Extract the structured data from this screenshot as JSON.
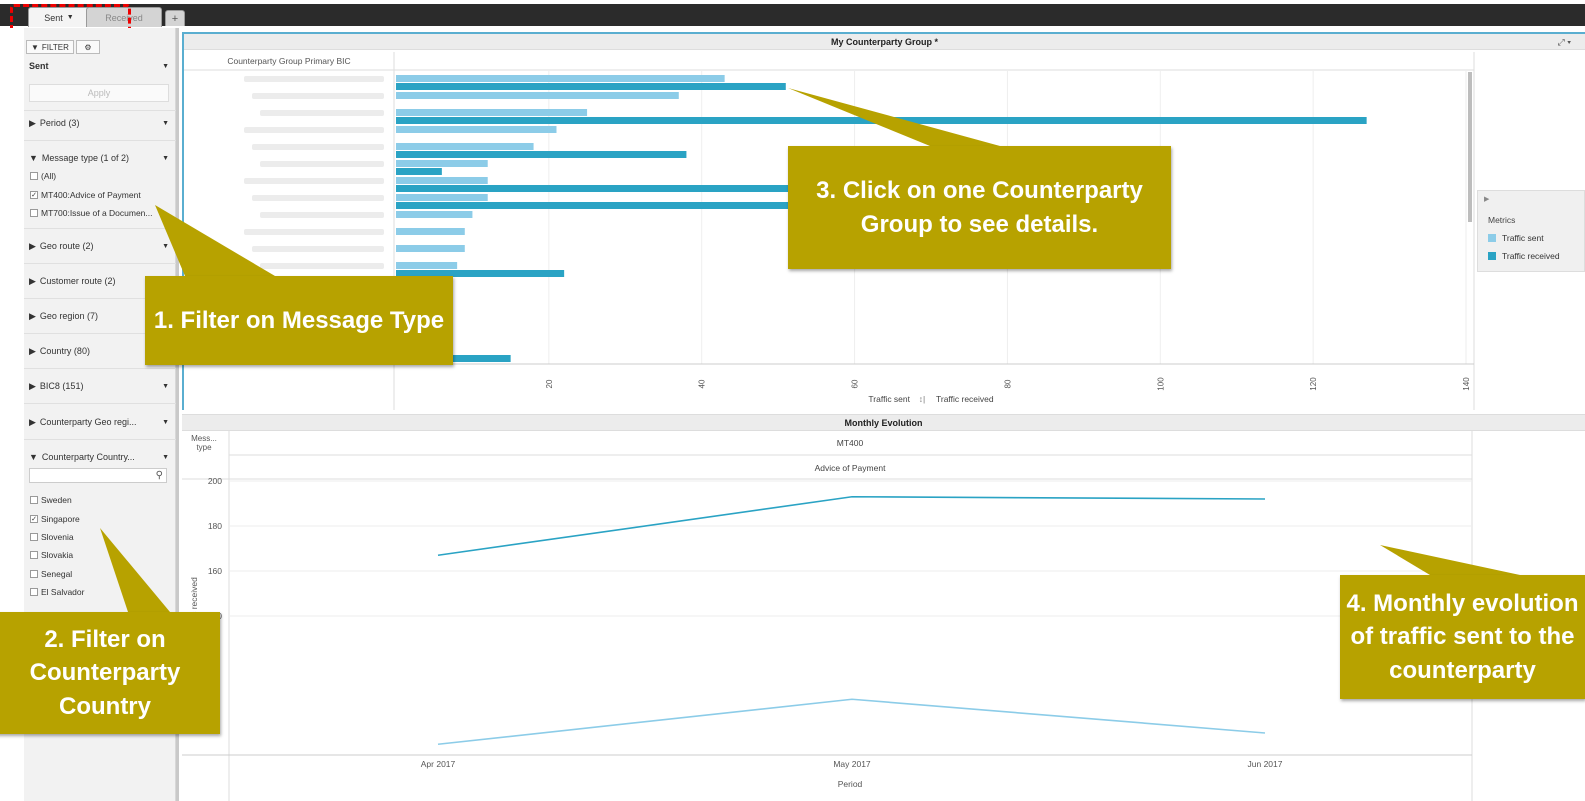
{
  "tabs": [
    {
      "label": "Sent",
      "active": true
    },
    {
      "label": "Received",
      "active": false
    }
  ],
  "add_tab": "+",
  "sidebar": {
    "filter_tab": "FILTER",
    "view_select": "Sent",
    "apply": "Apply",
    "sections": {
      "period": "Period (3)",
      "message_type": "Message type (1 of 2)",
      "geo_route": "Geo route (2)",
      "customer_route": "Customer route (2)",
      "geo_region": "Geo region (7)",
      "country": "Country (80)",
      "bic8": "BIC8 (151)",
      "cp_geo_region": "Counterparty Geo regi...",
      "cp_country": "Counterparty Country..."
    },
    "message_type_options": [
      {
        "label": "(All)",
        "checked": false
      },
      {
        "label": "MT400:Advice of Payment",
        "checked": true
      },
      {
        "label": "MT700:Issue of a Documen...",
        "checked": false
      }
    ],
    "country_options": [
      {
        "label": "Sweden",
        "checked": false
      },
      {
        "label": "Singapore",
        "checked": true
      },
      {
        "label": "Slovenia",
        "checked": false
      },
      {
        "label": "Slovakia",
        "checked": false
      },
      {
        "label": "Senegal",
        "checked": false
      },
      {
        "label": "El Salvador",
        "checked": false
      }
    ]
  },
  "colors": {
    "traffic_sent": "#8ccce8",
    "traffic_received": "#2aa3c4",
    "callout": "#b7a200",
    "panel_border": "#5aaed0"
  },
  "top_panel": {
    "title": "My Counterparty Group *",
    "column_header": "Counterparty Group Primary BIC",
    "axis_caption_sent": "Traffic sent",
    "axis_caption_received": "Traffic received"
  },
  "legend": {
    "title": "Metrics",
    "items": [
      "Traffic sent",
      "Traffic received"
    ]
  },
  "bottom_panel": {
    "title": "Monthly Evolution",
    "mess_type_header": "Mess... type",
    "mt": "MT400",
    "mt_desc": "Advice of Payment",
    "period_label": "Period",
    "ylabel": "Traffic received"
  },
  "callouts": {
    "c1": "1. Filter on Message Type",
    "c2": "2. Filter on Counterparty Country",
    "c3": "3. Click on one Counterparty Group to see details.",
    "c4": "4. Monthly evolution of traffic sent to the counterparty"
  },
  "chart_data": [
    {
      "type": "bar",
      "orientation": "horizontal",
      "categories": [
        "",
        "",
        "",
        "",
        "",
        "",
        "",
        "",
        "",
        "",
        "",
        "",
        "",
        "",
        "",
        "",
        ""
      ],
      "series": [
        {
          "name": "Traffic sent",
          "values": [
            43,
            37,
            25,
            21,
            18,
            12,
            12,
            12,
            10,
            9,
            9,
            8,
            0,
            0,
            0,
            0,
            0
          ]
        },
        {
          "name": "Traffic received",
          "values": [
            51,
            0,
            127,
            0,
            38,
            6,
            60,
            60,
            0,
            0,
            0,
            22,
            0,
            0,
            0,
            0,
            15
          ]
        }
      ],
      "xlim": [
        0,
        140
      ],
      "xticks": [
        20,
        40,
        60,
        80,
        100,
        120,
        140
      ]
    },
    {
      "type": "line",
      "categories": [
        "Apr 2017",
        "May 2017",
        "Jun 2017"
      ],
      "series": [
        {
          "name": "Traffic received",
          "values": [
            167,
            193,
            192
          ]
        },
        {
          "name": "Traffic sent",
          "values": [
            83,
            103,
            88
          ]
        }
      ],
      "ylim": [
        80,
        200
      ],
      "yticks": [
        140,
        160,
        180,
        200
      ]
    }
  ]
}
